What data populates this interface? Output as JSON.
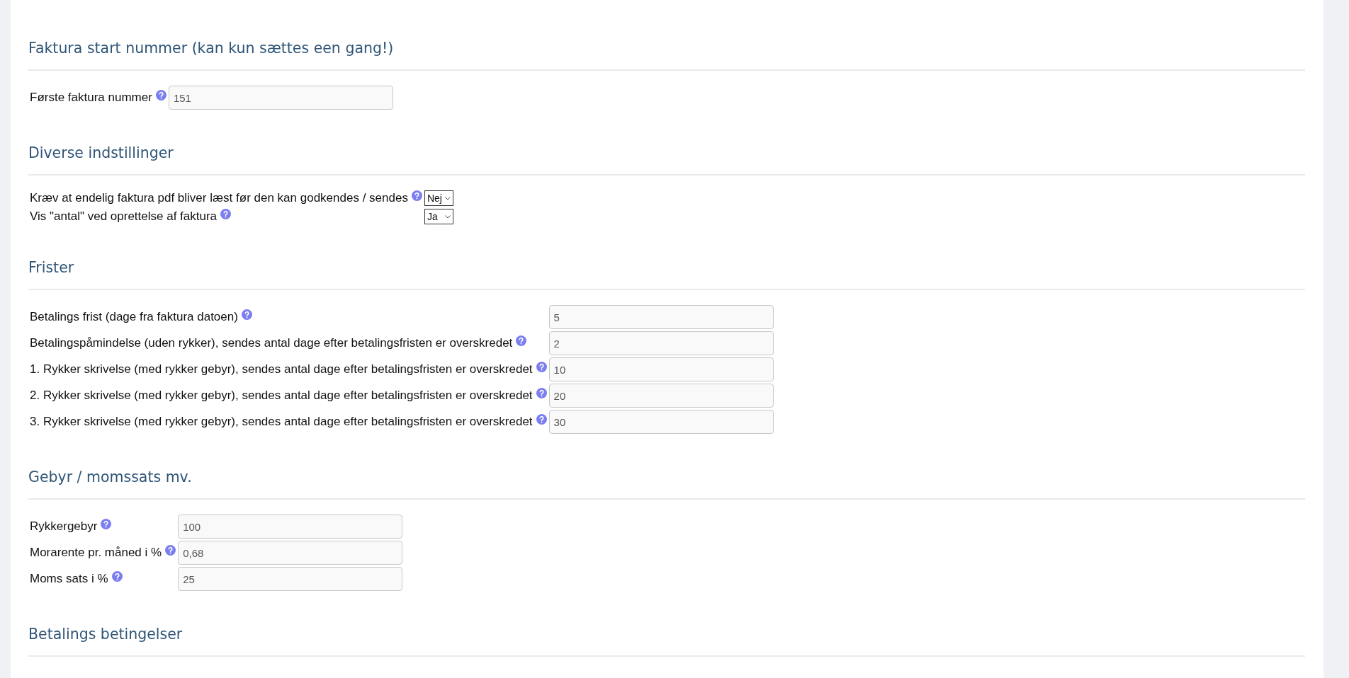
{
  "sections": [
    {
      "title": "Faktura start nummer (kan kun sættes een gang!)",
      "kind": "inputs",
      "fields": [
        {
          "label": "Første faktura nummer",
          "value": "151"
        }
      ]
    },
    {
      "title": "Diverse indstillinger",
      "kind": "selects",
      "fields": [
        {
          "label": "Kræv at endelig faktura pdf bliver læst før den kan godkendes / sendes",
          "value": "Nej"
        },
        {
          "label": "Vis \"antal\" ved oprettelse af faktura",
          "value": "Ja"
        }
      ]
    },
    {
      "title": "Frister",
      "kind": "inputs",
      "fields": [
        {
          "label": "Betalings frist (dage fra faktura datoen)",
          "value": "5"
        },
        {
          "label": "Betalingspåmindelse (uden rykker), sendes antal dage efter betalingsfristen er overskredet",
          "value": "2"
        },
        {
          "label": "1. Rykker skrivelse (med rykker gebyr), sendes antal dage efter betalingsfristen er overskredet",
          "value": "10"
        },
        {
          "label": "2. Rykker skrivelse (med rykker gebyr), sendes antal dage efter betalingsfristen er overskredet",
          "value": "20"
        },
        {
          "label": "3. Rykker skrivelse (med rykker gebyr), sendes antal dage efter betalingsfristen er overskredet",
          "value": "30"
        }
      ]
    },
    {
      "title": "Gebyr / momssats mv.",
      "kind": "inputs",
      "fields": [
        {
          "label": "Rykkergebyr",
          "value": "100"
        },
        {
          "label": "Morarente pr. måned i %",
          "value": "0,68"
        },
        {
          "label": "Moms sats i %",
          "value": "25"
        }
      ]
    },
    {
      "title": "Betalings betingelser",
      "kind": "empty"
    }
  ]
}
